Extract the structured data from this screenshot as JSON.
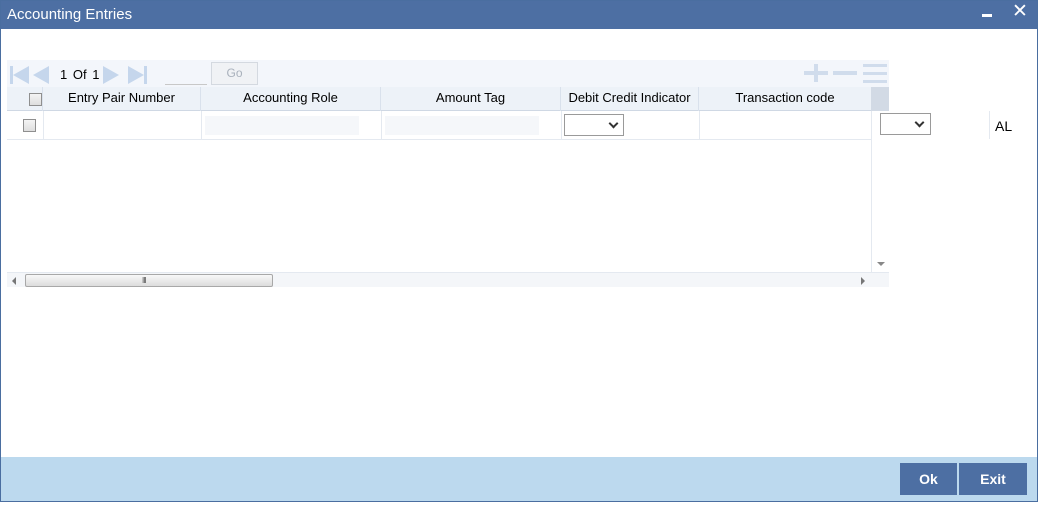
{
  "window": {
    "title": "Accounting Entries",
    "minimize_icon": "minimize-icon",
    "close_icon": "close-icon",
    "close_glyph": "✕"
  },
  "toolbar": {
    "page_current": "1",
    "page_of": "Of",
    "page_total": "1",
    "page_input_value": "",
    "go_label": "Go",
    "icons": [
      "first-page-icon",
      "previous-page-icon",
      "next-page-icon",
      "last-page-icon",
      "add-row-icon",
      "delete-row-icon",
      "single-view-icon"
    ]
  },
  "table": {
    "columns": [
      "Entry Pair Number",
      "Accounting Role",
      "Amount Tag",
      "Debit Credit Indicator",
      "Transaction code"
    ],
    "rows": [
      {
        "entry_pair_number": "",
        "accounting_role": "",
        "amount_tag": "",
        "debit_credit_indicator": "",
        "transaction_code": ""
      }
    ],
    "extra_select_value": "",
    "extra_text": "AL",
    "scroll_grip": "III"
  },
  "footer": {
    "ok_label": "Ok",
    "exit_label": "Exit"
  },
  "colors": {
    "titlebar": "#4d6fa3",
    "footer": "#bcd9ee",
    "button": "#4d6fa3"
  }
}
